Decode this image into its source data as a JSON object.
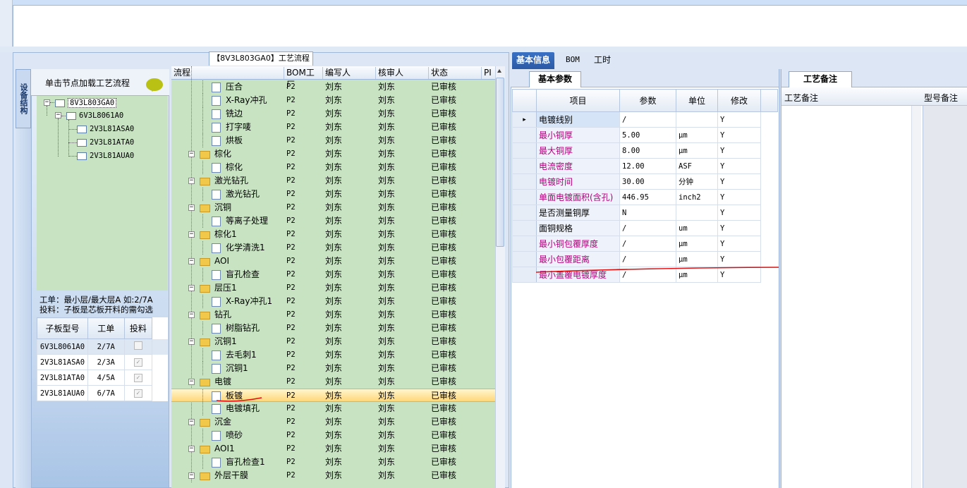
{
  "flow_tab_title": "【8V3L803GA0】工艺流程",
  "vertical_tab": "设备结构",
  "tree": {
    "header": "单击节点加载工艺流程",
    "nodes": [
      {
        "label": "8V3L803GA0"
      },
      {
        "label": "6V3L8061A0"
      },
      {
        "label": "2V3L81ASA0"
      },
      {
        "label": "2V3L81ATA0"
      },
      {
        "label": "2V3L81AUA0"
      }
    ]
  },
  "notes": {
    "line1": "工单：最小层/最大层A 如:2/7A",
    "line2": "投料：子板是芯板开料的需勾选"
  },
  "sub_table": {
    "headers": [
      "子板型号",
      "工单",
      "投料"
    ],
    "rows": [
      {
        "model": "6V3L8061A0",
        "order": "2/7A",
        "feed": ""
      },
      {
        "model": "2V3L81ASA0",
        "order": "2/3A",
        "feed": "✓"
      },
      {
        "model": "2V3L81ATA0",
        "order": "4/5A",
        "feed": "✓"
      },
      {
        "model": "2V3L81AUA0",
        "order": "6/7A",
        "feed": "✓"
      }
    ]
  },
  "flow_grid": {
    "headers": [
      "流程",
      "BOM工厂",
      "编写人",
      "核审人",
      "状态",
      "PI"
    ],
    "rows": [
      {
        "name": "压合",
        "type": "doc",
        "level": 2,
        "plant": "P2",
        "author": "刘东",
        "reviewer": "刘东",
        "status": "已审核"
      },
      {
        "name": "X-Ray冲孔",
        "type": "doc",
        "level": 2,
        "plant": "P2",
        "author": "刘东",
        "reviewer": "刘东",
        "status": "已审核"
      },
      {
        "name": "铣边",
        "type": "doc",
        "level": 2,
        "plant": "P2",
        "author": "刘东",
        "reviewer": "刘东",
        "status": "已审核"
      },
      {
        "name": "打字唛",
        "type": "doc",
        "level": 2,
        "plant": "P2",
        "author": "刘东",
        "reviewer": "刘东",
        "status": "已审核"
      },
      {
        "name": "烘板",
        "type": "doc",
        "level": 2,
        "plant": "P2",
        "author": "刘东",
        "reviewer": "刘东",
        "status": "已审核"
      },
      {
        "name": "棕化",
        "type": "folder",
        "level": 1,
        "plant": "P2",
        "author": "刘东",
        "reviewer": "刘东",
        "status": "已审核"
      },
      {
        "name": "棕化",
        "type": "doc",
        "level": 2,
        "plant": "P2",
        "author": "刘东",
        "reviewer": "刘东",
        "status": "已审核"
      },
      {
        "name": "激光钻孔",
        "type": "folder",
        "level": 1,
        "plant": "P2",
        "author": "刘东",
        "reviewer": "刘东",
        "status": "已审核"
      },
      {
        "name": "激光钻孔",
        "type": "doc",
        "level": 2,
        "plant": "P2",
        "author": "刘东",
        "reviewer": "刘东",
        "status": "已审核"
      },
      {
        "name": "沉铜",
        "type": "folder",
        "level": 1,
        "plant": "P2",
        "author": "刘东",
        "reviewer": "刘东",
        "status": "已审核"
      },
      {
        "name": "等离子处理",
        "type": "doc",
        "level": 2,
        "plant": "P2",
        "author": "刘东",
        "reviewer": "刘东",
        "status": "已审核"
      },
      {
        "name": "棕化1",
        "type": "folder",
        "level": 1,
        "plant": "P2",
        "author": "刘东",
        "reviewer": "刘东",
        "status": "已审核"
      },
      {
        "name": "化学清洗1",
        "type": "doc",
        "level": 2,
        "plant": "P2",
        "author": "刘东",
        "reviewer": "刘东",
        "status": "已审核"
      },
      {
        "name": "AOI",
        "type": "folder",
        "level": 1,
        "plant": "P2",
        "author": "刘东",
        "reviewer": "刘东",
        "status": "已审核"
      },
      {
        "name": "盲孔检查",
        "type": "doc",
        "level": 2,
        "plant": "P2",
        "author": "刘东",
        "reviewer": "刘东",
        "status": "已审核"
      },
      {
        "name": "层压1",
        "type": "folder",
        "level": 1,
        "plant": "P2",
        "author": "刘东",
        "reviewer": "刘东",
        "status": "已审核"
      },
      {
        "name": "X-Ray冲孔1",
        "type": "doc",
        "level": 2,
        "plant": "P2",
        "author": "刘东",
        "reviewer": "刘东",
        "status": "已审核"
      },
      {
        "name": "钻孔",
        "type": "folder",
        "level": 1,
        "plant": "P2",
        "author": "刘东",
        "reviewer": "刘东",
        "status": "已审核"
      },
      {
        "name": "树脂钻孔",
        "type": "doc",
        "level": 2,
        "plant": "P2",
        "author": "刘东",
        "reviewer": "刘东",
        "status": "已审核"
      },
      {
        "name": "沉铜1",
        "type": "folder",
        "level": 1,
        "plant": "P2",
        "author": "刘东",
        "reviewer": "刘东",
        "status": "已审核"
      },
      {
        "name": "去毛刺1",
        "type": "doc",
        "level": 2,
        "plant": "P2",
        "author": "刘东",
        "reviewer": "刘东",
        "status": "已审核"
      },
      {
        "name": "沉铜1",
        "type": "doc",
        "level": 2,
        "plant": "P2",
        "author": "刘东",
        "reviewer": "刘东",
        "status": "已审核"
      },
      {
        "name": "电镀",
        "type": "folder",
        "level": 1,
        "plant": "P2",
        "author": "刘东",
        "reviewer": "刘东",
        "status": "已审核"
      },
      {
        "name": "板镀",
        "type": "doc",
        "level": 2,
        "plant": "P2",
        "author": "刘东",
        "reviewer": "刘东",
        "status": "已审核",
        "selected": true
      },
      {
        "name": "电镀填孔",
        "type": "doc",
        "level": 2,
        "plant": "P2",
        "author": "刘东",
        "reviewer": "刘东",
        "status": "已审核"
      },
      {
        "name": "沉金",
        "type": "folder",
        "level": 1,
        "plant": "P2",
        "author": "刘东",
        "reviewer": "刘东",
        "status": "已审核"
      },
      {
        "name": "喷砂",
        "type": "doc",
        "level": 2,
        "plant": "P2",
        "author": "刘东",
        "reviewer": "刘东",
        "status": "已审核"
      },
      {
        "name": "AOI1",
        "type": "folder",
        "level": 1,
        "plant": "P2",
        "author": "刘东",
        "reviewer": "刘东",
        "status": "已审核"
      },
      {
        "name": "盲孔检查1",
        "type": "doc",
        "level": 2,
        "plant": "P2",
        "author": "刘东",
        "reviewer": "刘东",
        "status": "已审核"
      },
      {
        "name": "外层干膜",
        "type": "folder",
        "level": 1,
        "plant": "P2",
        "author": "刘东",
        "reviewer": "刘东",
        "status": "已审核"
      }
    ]
  },
  "right_tabs": [
    "基本信息",
    "BOM",
    "工时"
  ],
  "param_subtab": "基本参数",
  "param_table": {
    "headers": [
      "项目",
      "参数",
      "单位",
      "修改"
    ],
    "rows": [
      {
        "item": "电镀线别",
        "value": "/",
        "unit": "",
        "edit": "Y",
        "color": "black"
      },
      {
        "item": "最小铜厚",
        "value": "5.00",
        "unit": "μm",
        "edit": "Y",
        "color": "pink"
      },
      {
        "item": "最大铜厚",
        "value": "8.00",
        "unit": "μm",
        "edit": "Y",
        "color": "pink"
      },
      {
        "item": "电流密度",
        "value": "12.00",
        "unit": "ASF",
        "edit": "Y",
        "color": "pink"
      },
      {
        "item": "电镀时间",
        "value": "30.00",
        "unit": "分钟",
        "edit": "Y",
        "color": "pink"
      },
      {
        "item": "单面电镀面积(含孔)",
        "value": "446.95",
        "unit": "inch2",
        "edit": "Y",
        "color": "pink"
      },
      {
        "item": "是否测量铜厚",
        "value": "N",
        "unit": "",
        "edit": "Y",
        "color": "black"
      },
      {
        "item": "面铜规格",
        "value": "/",
        "unit": "um",
        "edit": "Y",
        "color": "black"
      },
      {
        "item": "最小铜包覆厚度",
        "value": "/",
        "unit": "μm",
        "edit": "Y",
        "color": "pink"
      },
      {
        "item": "最小包覆距离",
        "value": "/",
        "unit": "μm",
        "edit": "Y",
        "color": "pink"
      },
      {
        "item": "最小盖覆电镀厚度",
        "value": "/",
        "unit": "μm",
        "edit": "Y",
        "color": "pink"
      }
    ]
  },
  "notes_panel": {
    "tab": "工艺备注",
    "headers": [
      "工艺备注",
      "型号备注"
    ]
  },
  "colors": {
    "flow_bg": "#c7e3c2",
    "selected_row": "#ffd77a",
    "active_tab": "#2b5aa6",
    "pink_text": "#b3007d",
    "annotation": "#e01010"
  }
}
